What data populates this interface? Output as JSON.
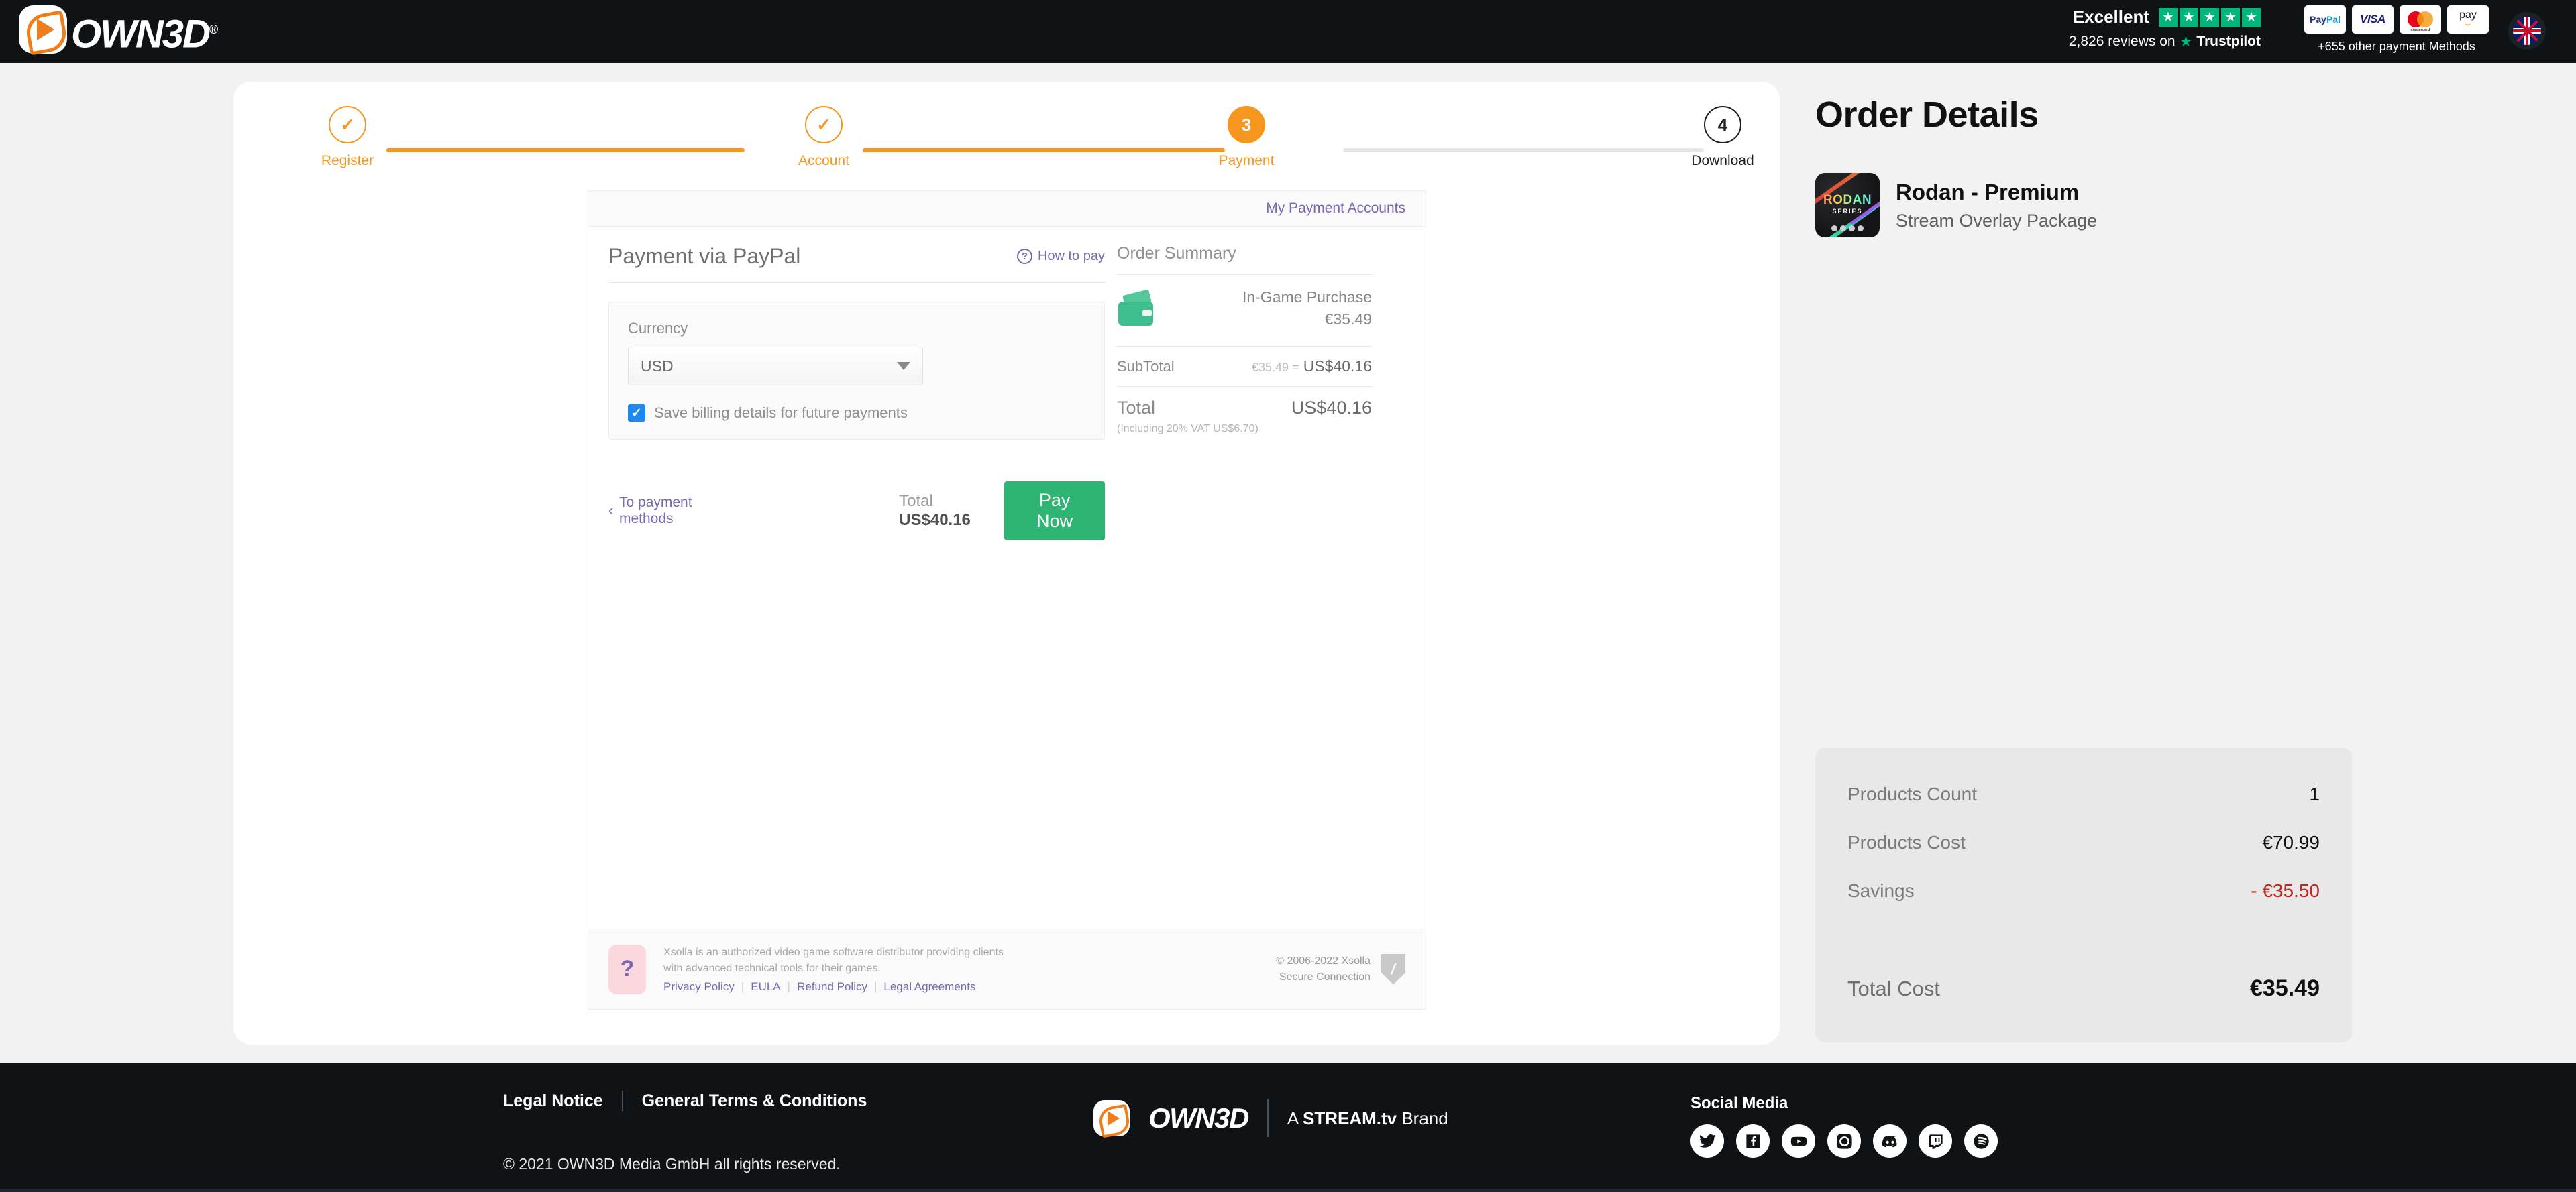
{
  "header": {
    "logo_text": "OWN3D",
    "logo_registered": "®",
    "trustpilot": {
      "rating_word": "Excellent",
      "stars": 5,
      "reviews_text": "2,826 reviews on",
      "brand": "Trustpilot",
      "star_color": "#00b67a"
    },
    "payment_logos": [
      {
        "name": "paypal-logo",
        "part1": "Pay",
        "part2": "Pal"
      },
      {
        "name": "visa-logo",
        "label": "VISA"
      },
      {
        "name": "mastercard-logo",
        "label": "mastercard"
      },
      {
        "name": "amazon-pay-logo",
        "label": "pay"
      }
    ],
    "payment_caption": "+655 other payment Methods",
    "language_flag": "uk-flag-icon"
  },
  "stepper": {
    "steps": [
      {
        "id": "register",
        "badge": "✓",
        "label": "Register",
        "state": "done"
      },
      {
        "id": "account",
        "badge": "✓",
        "label": "Account",
        "state": "done"
      },
      {
        "id": "payment",
        "badge": "3",
        "label": "Payment",
        "state": "active"
      },
      {
        "id": "download",
        "badge": "4",
        "label": "Download",
        "state": "todo"
      }
    ],
    "accent_color": "#f5961e",
    "inactive_color": "#e6e6e6"
  },
  "xsolla": {
    "my_payment_accounts": "My Payment Accounts",
    "title": "Payment via PayPal",
    "how_to_pay": "How to pay",
    "how_to_pay_icon": "?",
    "currency_label": "Currency",
    "currency_value": "USD",
    "save_billing_label": "Save billing details for future payments",
    "save_billing_checked": true,
    "back_link": "To payment methods",
    "back_chevron": "‹",
    "total_label": "Total",
    "total_value": "US$40.16",
    "pay_now": "Pay Now",
    "pay_now_color": "#2fb573",
    "order_summary": {
      "title": "Order Summary",
      "item_name": "In-Game Purchase",
      "item_price": "€35.49",
      "item_icon": "wallet-icon",
      "subtotal_label": "SubTotal",
      "subtotal_original": "€35.49 =",
      "subtotal_value": "US$40.16",
      "total_label": "Total",
      "total_value": "US$40.16",
      "vat_note": "(Including 20% VAT  US$6.70)"
    },
    "footer": {
      "bunny_icon": "?",
      "line1": "Xsolla is an authorized video game software distributor providing clients",
      "line2": "with advanced technical tools for their games.",
      "links": [
        "Privacy Policy",
        "EULA",
        "Refund Policy",
        "Legal Agreements"
      ],
      "copyright": "© 2006-2022 Xsolla",
      "secure": "Secure Connection",
      "shield_icon": "shield-icon"
    }
  },
  "order_details": {
    "title": "Order Details",
    "product": {
      "thumb_title": "RODAN",
      "thumb_sub": "SERIES",
      "name": "Rodan - Premium",
      "subtitle": "Stream Overlay Package"
    },
    "totals": {
      "rows": [
        {
          "label": "Products Count",
          "value": "1",
          "negative": false
        },
        {
          "label": "Products Cost",
          "value": "€70.99",
          "negative": false
        },
        {
          "label": "Savings",
          "value": "- €35.50",
          "negative": true
        }
      ],
      "grand_label": "Total Cost",
      "grand_value": "€35.49",
      "savings_color": "#c1271b"
    }
  },
  "footer": {
    "links": [
      "Legal Notice",
      "General Terms & Conditions"
    ],
    "copyright": "© 2021 OWN3D Media GmbH all rights reserved.",
    "brand_logo_text": "OWN3D",
    "brand_prefix": "A ",
    "brand_strong": "STREAM.tv",
    "brand_suffix": " Brand",
    "social_label": "Social Media",
    "social_icons": [
      "twitter-icon",
      "facebook-icon",
      "youtube-icon",
      "instagram-icon",
      "discord-icon",
      "twitch-icon",
      "spotify-icon"
    ]
  }
}
